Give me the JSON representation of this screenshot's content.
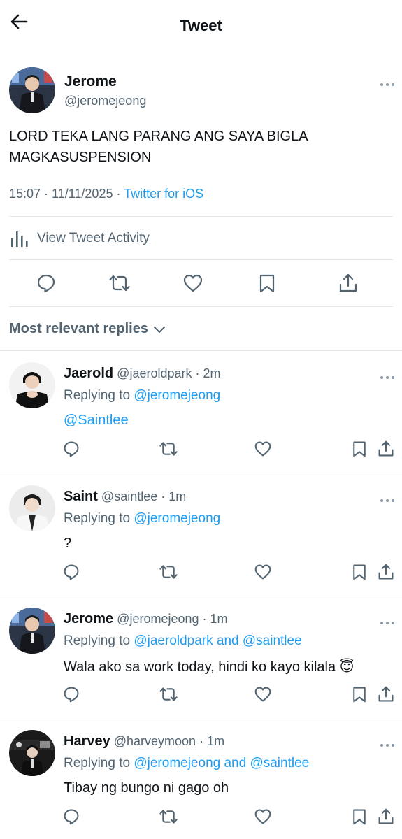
{
  "header": {
    "title": "Tweet",
    "back_icon": "arrow-left-icon"
  },
  "tweet": {
    "name": "Jerome",
    "handle": "@jeromejeong",
    "text": "LORD TEKA LANG PARANG ANG SAYA BIGLA MAGKASUSPENSION",
    "time": "15:07",
    "date": "11/11/2025",
    "source": "Twitter for iOS",
    "activity_label": "View Tweet Activity"
  },
  "actions": [
    "reply-icon",
    "retweet-icon",
    "like-icon",
    "bookmark-icon",
    "share-icon"
  ],
  "replies_header": "Most relevant replies",
  "replies": [
    {
      "name": "Jaerold",
      "handle": "@jaeroldpark",
      "sep": "·",
      "time": "2m",
      "replying_prefix": "Replying to",
      "replying_to": "@jeromejeong",
      "text": "@Saintlee",
      "text_is_link": true
    },
    {
      "name": "Saint",
      "handle": "@saintlee",
      "sep": "·",
      "time": "1m",
      "replying_prefix": "Replying to",
      "replying_to": "@jeromejeong",
      "text": "?",
      "text_is_link": false
    },
    {
      "name": "Jerome",
      "handle": "@jeromejeong",
      "sep": "·",
      "time": "1m",
      "replying_prefix": "Replying to",
      "replying_to": "@jaeroldpark and @saintlee",
      "text": "Wala ako sa work today, hindi ko kayo kilala",
      "emoji": "😇",
      "text_is_link": false
    },
    {
      "name": "Harvey",
      "handle": "@harveymoon",
      "sep": "·",
      "time": "1m",
      "replying_prefix": "Replying to",
      "replying_to": "@jeromejeong and @saintlee",
      "text": "Tibay ng bungo ni gago oh",
      "text_is_link": false
    }
  ],
  "colors": {
    "link": "#1d9bf0",
    "muted": "#536471",
    "divider": "#e4e7ea",
    "text": "#0f1419"
  }
}
